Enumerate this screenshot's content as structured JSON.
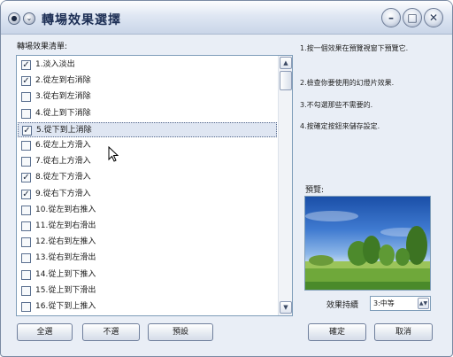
{
  "window": {
    "title": "轉場效果選擇",
    "controls": {
      "minimize": "–",
      "maximize": "□",
      "close": "✕"
    }
  },
  "list": {
    "label": "轉場效果清單:",
    "items": [
      {
        "label": "1.淡入淡出",
        "checked": true
      },
      {
        "label": "2.從左到右消除",
        "checked": true
      },
      {
        "label": "3.從右到左消除",
        "checked": false
      },
      {
        "label": "4.從上到下消除",
        "checked": false
      },
      {
        "label": "5.從下到上消除",
        "checked": true,
        "selected": true
      },
      {
        "label": "6.從左上方滑入",
        "checked": false
      },
      {
        "label": "7.從右上方滑入",
        "checked": false
      },
      {
        "label": "8.從左下方滑入",
        "checked": true
      },
      {
        "label": "9.從右下方滑入",
        "checked": true
      },
      {
        "label": "10.從左到右推入",
        "checked": false
      },
      {
        "label": "11.從左到右滑出",
        "checked": false
      },
      {
        "label": "12.從右到左推入",
        "checked": false
      },
      {
        "label": "13.從右到左滑出",
        "checked": false
      },
      {
        "label": "14.從上到下推入",
        "checked": false
      },
      {
        "label": "15.從上到下滑出",
        "checked": false
      },
      {
        "label": "16.從下到上推入",
        "checked": false
      }
    ]
  },
  "instructions": [
    "1.按一個效果在預覽視窗下預覽它.",
    "2.檢查你要使用的幻燈片效果.",
    "3.不勾選那些不需要的.",
    "4.按確定按鈕來儲存設定."
  ],
  "preview": {
    "label": "預覽:"
  },
  "duration": {
    "label": "效果持續",
    "value": "3:中等"
  },
  "buttons": {
    "select_all": "全選",
    "select_none": "不選",
    "default": "預設",
    "ok": "確定",
    "cancel": "取消"
  },
  "icons": {
    "checkmark": "check-icon",
    "scroll_up": "arrow-up-icon",
    "scroll_down": "arrow-down-icon",
    "cursor": "mouse-pointer-icon"
  }
}
